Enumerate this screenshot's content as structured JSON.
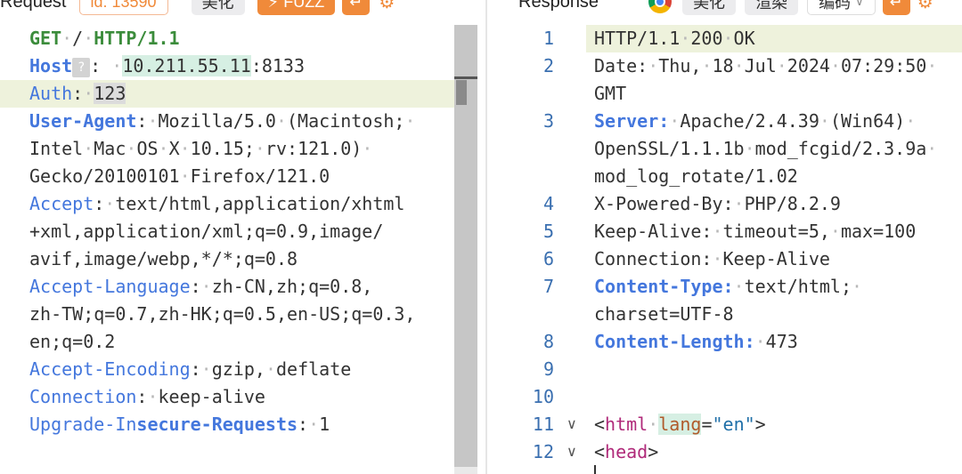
{
  "request": {
    "title": "Request",
    "id_badge": "id: 13590",
    "beautify_label": "美化",
    "fuzz_label": "FUZZ",
    "lines": [
      {
        "parts": [
          [
            "kw-green",
            "GET"
          ],
          [
            "dot",
            "·"
          ],
          [
            "",
            "/"
          ],
          [
            "dot",
            "·"
          ],
          [
            "kw-green",
            "HTTP/1.1"
          ]
        ]
      },
      {
        "parts": [
          [
            "kw-blue",
            "Host"
          ],
          [
            "qmark",
            "?"
          ],
          [
            "",
            ": "
          ],
          [
            "dot",
            "·"
          ],
          [
            "val-hl",
            "10.211.55.11"
          ],
          [
            "",
            ":8133"
          ]
        ]
      },
      {
        "hl": true,
        "parts": [
          [
            "kw-blue-n",
            "Auth"
          ],
          [
            "",
            ":"
          ],
          [
            "dot",
            "·"
          ],
          [
            "val-gray",
            "123"
          ]
        ]
      },
      {
        "parts": [
          [
            "kw-blue",
            "User-Agent"
          ],
          [
            "",
            ":"
          ],
          [
            "dot",
            "·"
          ],
          [
            "",
            "Mozilla/5.0"
          ],
          [
            "dot",
            "·"
          ],
          [
            "",
            "(Macintosh;"
          ],
          [
            "dot",
            "·"
          ]
        ]
      },
      {
        "parts": [
          [
            "",
            "Intel"
          ],
          [
            "dot",
            "·"
          ],
          [
            "",
            "Mac"
          ],
          [
            "dot",
            "·"
          ],
          [
            "",
            "OS"
          ],
          [
            "dot",
            "·"
          ],
          [
            "",
            "X"
          ],
          [
            "dot",
            "·"
          ],
          [
            "",
            "10.15;"
          ],
          [
            "dot",
            "·"
          ],
          [
            "",
            "rv:121.0)"
          ],
          [
            "dot",
            "·"
          ]
        ]
      },
      {
        "parts": [
          [
            "",
            "Gecko/20100101"
          ],
          [
            "dot",
            "·"
          ],
          [
            "",
            "Firefox/121.0"
          ]
        ]
      },
      {
        "parts": [
          [
            "kw-blue-n",
            "Accept"
          ],
          [
            "",
            ":"
          ],
          [
            "dot",
            "·"
          ],
          [
            "",
            "text/html,application/xhtml"
          ]
        ]
      },
      {
        "parts": [
          [
            "",
            "+xml,application/xml;q=0.9,image/"
          ]
        ]
      },
      {
        "parts": [
          [
            "",
            "avif,image/webp,*/*;q=0.8"
          ]
        ]
      },
      {
        "parts": [
          [
            "kw-blue-n",
            "Accept-Language"
          ],
          [
            "",
            ":"
          ],
          [
            "dot",
            "·"
          ],
          [
            "",
            "zh-CN,zh;q=0.8,"
          ]
        ]
      },
      {
        "parts": [
          [
            "",
            "zh-TW;q=0.7,zh-HK;q=0.5,en-US;q=0.3,"
          ]
        ]
      },
      {
        "parts": [
          [
            "",
            "en;q=0.2"
          ]
        ]
      },
      {
        "parts": [
          [
            "kw-blue-n",
            "Accept-Encoding"
          ],
          [
            "",
            ":"
          ],
          [
            "dot",
            "·"
          ],
          [
            "",
            "gzip,"
          ],
          [
            "dot",
            "·"
          ],
          [
            "",
            "deflate"
          ]
        ]
      },
      {
        "parts": [
          [
            "kw-blue-n",
            "Connection"
          ],
          [
            "",
            ":"
          ],
          [
            "dot",
            "·"
          ],
          [
            "",
            "keep-alive"
          ]
        ]
      },
      {
        "parts": [
          [
            "kw-blue-n",
            "Upgrade-In"
          ],
          [
            "kw-blue",
            "secure-Requests"
          ],
          [
            "",
            ":"
          ],
          [
            "dot",
            "·"
          ],
          [
            "",
            "1"
          ]
        ]
      }
    ]
  },
  "response": {
    "title": "Response",
    "beautify_label": "美化",
    "render_label": "渲染",
    "encoding_label": "编码",
    "lines": [
      {
        "num": "1",
        "hl": true,
        "parts": [
          [
            "",
            "HTTP/1.1"
          ],
          [
            "dot",
            "·"
          ],
          [
            "",
            "200"
          ],
          [
            "dot",
            "·"
          ],
          [
            "",
            "OK"
          ]
        ]
      },
      {
        "num": "2",
        "parts": [
          [
            "",
            "Date:"
          ],
          [
            "dot",
            "·"
          ],
          [
            "",
            "Thu,"
          ],
          [
            "dot",
            "·"
          ],
          [
            "",
            "18"
          ],
          [
            "dot",
            "·"
          ],
          [
            "",
            "Jul"
          ],
          [
            "dot",
            "·"
          ],
          [
            "",
            "2024"
          ],
          [
            "dot",
            "·"
          ],
          [
            "",
            "07:29:50"
          ],
          [
            "dot",
            "·"
          ]
        ]
      },
      {
        "num": "",
        "parts": [
          [
            "",
            "GMT"
          ]
        ]
      },
      {
        "num": "3",
        "parts": [
          [
            "kw-blue",
            "Server:"
          ],
          [
            "dot",
            "·"
          ],
          [
            "",
            "Apache/2.4.39"
          ],
          [
            "dot",
            "·"
          ],
          [
            "",
            "(Win64)"
          ],
          [
            "dot",
            "·"
          ]
        ]
      },
      {
        "num": "",
        "parts": [
          [
            "",
            "OpenSSL/1.1.1b"
          ],
          [
            "dot",
            "·"
          ],
          [
            "",
            "mod_fcgid/2.3.9a"
          ],
          [
            "dot",
            "·"
          ]
        ]
      },
      {
        "num": "",
        "parts": [
          [
            "",
            "mod_log_rotate/1.02"
          ]
        ]
      },
      {
        "num": "4",
        "parts": [
          [
            "",
            "X-Powered-By:"
          ],
          [
            "dot",
            "·"
          ],
          [
            "",
            "PHP/8.2.9"
          ]
        ]
      },
      {
        "num": "5",
        "parts": [
          [
            "",
            "Keep-Alive:"
          ],
          [
            "dot",
            "·"
          ],
          [
            "",
            "timeout=5,"
          ],
          [
            "dot",
            "·"
          ],
          [
            "",
            "max=100"
          ]
        ]
      },
      {
        "num": "6",
        "parts": [
          [
            "",
            "Connection:"
          ],
          [
            "dot",
            "·"
          ],
          [
            "",
            "Keep-Alive"
          ]
        ]
      },
      {
        "num": "7",
        "parts": [
          [
            "kw-blue",
            "Content-Type:"
          ],
          [
            "dot",
            "·"
          ],
          [
            "",
            "text/html;"
          ],
          [
            "dot",
            "·"
          ]
        ]
      },
      {
        "num": "",
        "parts": [
          [
            "",
            "charset=UTF-8"
          ]
        ]
      },
      {
        "num": "8",
        "parts": [
          [
            "kw-blue",
            "Content-Length:"
          ],
          [
            "dot",
            "·"
          ],
          [
            "",
            "473"
          ]
        ]
      },
      {
        "num": "9",
        "parts": []
      },
      {
        "num": "10",
        "parts": []
      },
      {
        "num": "11",
        "fold": "∨",
        "parts": [
          [
            "",
            "<"
          ],
          [
            "tag",
            "html"
          ],
          [
            "dot",
            "·"
          ],
          [
            "attr",
            "lang"
          ],
          [
            "",
            "="
          ],
          [
            "str",
            "\"en\""
          ],
          [
            "",
            ">"
          ]
        ]
      },
      {
        "num": "12",
        "fold": "∨",
        "parts": [
          [
            "",
            "<"
          ],
          [
            "tag",
            "head"
          ],
          [
            "",
            ">"
          ]
        ]
      }
    ]
  },
  "colors": {
    "accent": "#f08a3a",
    "highlight": "#eef2dc",
    "keyword_blue": "#4477dd",
    "keyword_green": "#3b8c3b"
  },
  "icons": [
    "gear-icon",
    "lightning-icon",
    "return-icon",
    "chrome-icon",
    "chevron-down-icon",
    "help-icon",
    "fold-chevron-icon"
  ]
}
